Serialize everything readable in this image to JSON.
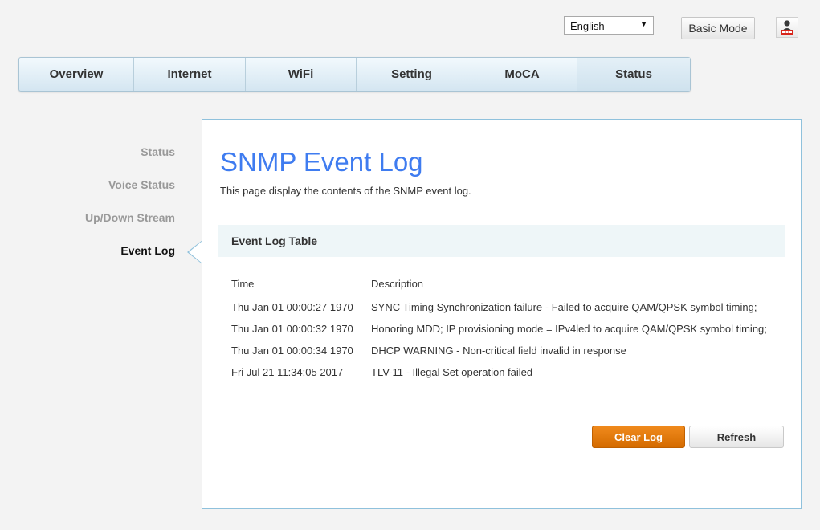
{
  "header": {
    "language": "English",
    "basic_mode_label": "Basic Mode",
    "user_icon": "user-logout-icon"
  },
  "nav": {
    "tabs": [
      {
        "label": "Overview"
      },
      {
        "label": "Internet"
      },
      {
        "label": "WiFi"
      },
      {
        "label": "Setting"
      },
      {
        "label": "MoCA"
      },
      {
        "label": "Status",
        "active": true
      }
    ]
  },
  "sidebar": {
    "items": [
      {
        "label": "Status"
      },
      {
        "label": "Voice Status"
      },
      {
        "label": "Up/Down Stream"
      },
      {
        "label": "Event Log",
        "active": true
      }
    ]
  },
  "main": {
    "title": "SNMP Event Log",
    "description": "This page display the contents of the SNMP event log.",
    "section_title": "Event Log Table",
    "table": {
      "columns": [
        "Time",
        "Description"
      ],
      "rows": [
        [
          "Thu Jan 01 00:00:27 1970",
          "SYNC Timing Synchronization failure - Failed to acquire QAM/QPSK symbol timing;"
        ],
        [
          "Thu Jan 01 00:00:32 1970",
          "Honoring MDD; IP provisioning mode = IPv4led to acquire QAM/QPSK symbol timing;"
        ],
        [
          "Thu Jan 01 00:00:34 1970",
          "DHCP WARNING - Non-critical field invalid in response"
        ],
        [
          "Fri Jul 21 11:34:05 2017",
          "TLV-11 - Illegal Set operation failed"
        ]
      ]
    },
    "buttons": {
      "clear_label": "Clear Log",
      "refresh_label": "Refresh"
    }
  },
  "colors": {
    "title": "#3f7cf0",
    "accent_orange": "#e07b0c",
    "panel_border": "#8fc1dc",
    "section_bg": "#eef6f8"
  }
}
